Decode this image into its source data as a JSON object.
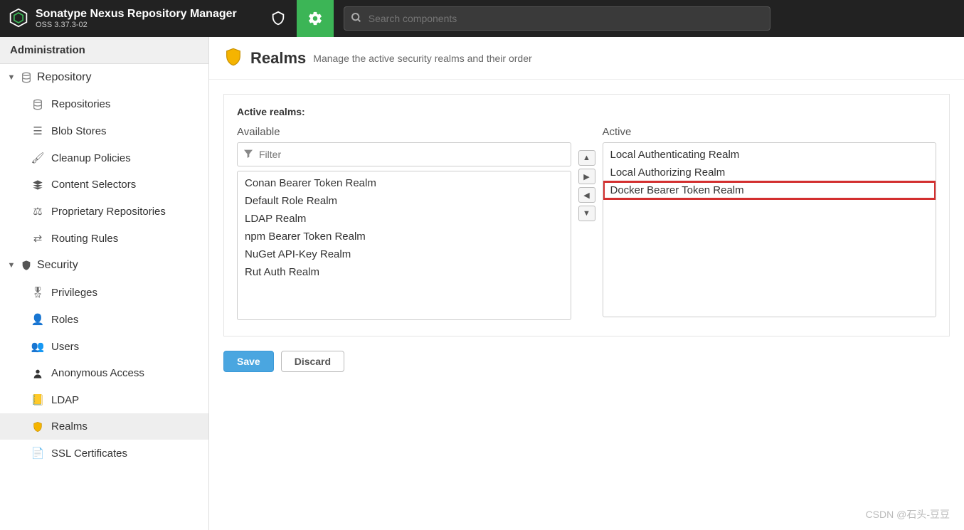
{
  "header": {
    "app_title": "Sonatype Nexus Repository Manager",
    "app_subtitle": "OSS 3.37.3-02",
    "search_placeholder": "Search components"
  },
  "sidebar": {
    "header": "Administration",
    "groups": [
      {
        "label": "Repository",
        "icon": "database",
        "items": [
          {
            "label": "Repositories",
            "icon": "database"
          },
          {
            "label": "Blob Stores",
            "icon": "stack"
          },
          {
            "label": "Cleanup Policies",
            "icon": "brush"
          },
          {
            "label": "Content Selectors",
            "icon": "layers"
          },
          {
            "label": "Proprietary Repositories",
            "icon": "proprietary"
          },
          {
            "label": "Routing Rules",
            "icon": "routing"
          }
        ]
      },
      {
        "label": "Security",
        "icon": "shield",
        "items": [
          {
            "label": "Privileges",
            "icon": "privilege"
          },
          {
            "label": "Roles",
            "icon": "role"
          },
          {
            "label": "Users",
            "icon": "users"
          },
          {
            "label": "Anonymous Access",
            "icon": "anonymous"
          },
          {
            "label": "LDAP",
            "icon": "book"
          },
          {
            "label": "Realms",
            "icon": "shield-yellow",
            "selected": true
          },
          {
            "label": "SSL Certificates",
            "icon": "certificate"
          }
        ]
      }
    ]
  },
  "page": {
    "title": "Realms",
    "description": "Manage the active security realms and their order"
  },
  "realms": {
    "section_label": "Active realms:",
    "available_label": "Available",
    "active_label": "Active",
    "filter_placeholder": "Filter",
    "available": [
      "Conan Bearer Token Realm",
      "Default Role Realm",
      "LDAP Realm",
      "npm Bearer Token Realm",
      "NuGet API-Key Realm",
      "Rut Auth Realm"
    ],
    "active": [
      {
        "label": "Local Authenticating Realm",
        "highlight": false
      },
      {
        "label": "Local Authorizing Realm",
        "highlight": false
      },
      {
        "label": "Docker Bearer Token Realm",
        "highlight": true
      }
    ]
  },
  "buttons": {
    "save": "Save",
    "discard": "Discard"
  },
  "watermark": "CSDN @石头-豆豆"
}
